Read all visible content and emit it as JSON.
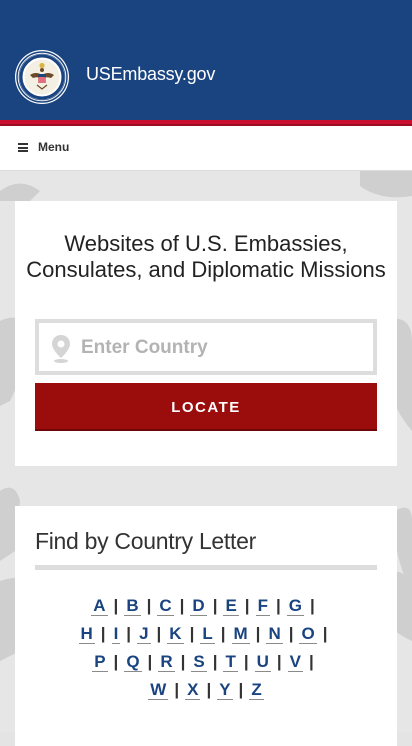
{
  "header": {
    "site_title": "USEmbassy.gov",
    "brand_color": "#1a4480",
    "stripe_color": "#c8102e",
    "seal_icon": "department-of-state-seal-icon"
  },
  "menu": {
    "label": "Menu",
    "icon": "hamburger-icon"
  },
  "search_card": {
    "title": "Websites of U.S. Embassies, Consulates, and Diplomatic Missions",
    "input_placeholder": "Enter Country",
    "input_value": "",
    "pin_icon": "location-pin-icon",
    "locate_label": "LOCATE",
    "locate_color": "#9b0d0d"
  },
  "letters_card": {
    "title": "Find by Country Letter",
    "rows": [
      [
        "A",
        "B",
        "C",
        "D",
        "E",
        "F",
        "G"
      ],
      [
        "H",
        "I",
        "J",
        "K",
        "L",
        "M",
        "N",
        "O"
      ],
      [
        "P",
        "Q",
        "R",
        "S",
        "T",
        "U",
        "V"
      ],
      [
        "W",
        "X",
        "Y",
        "Z"
      ]
    ],
    "separator": "|"
  }
}
